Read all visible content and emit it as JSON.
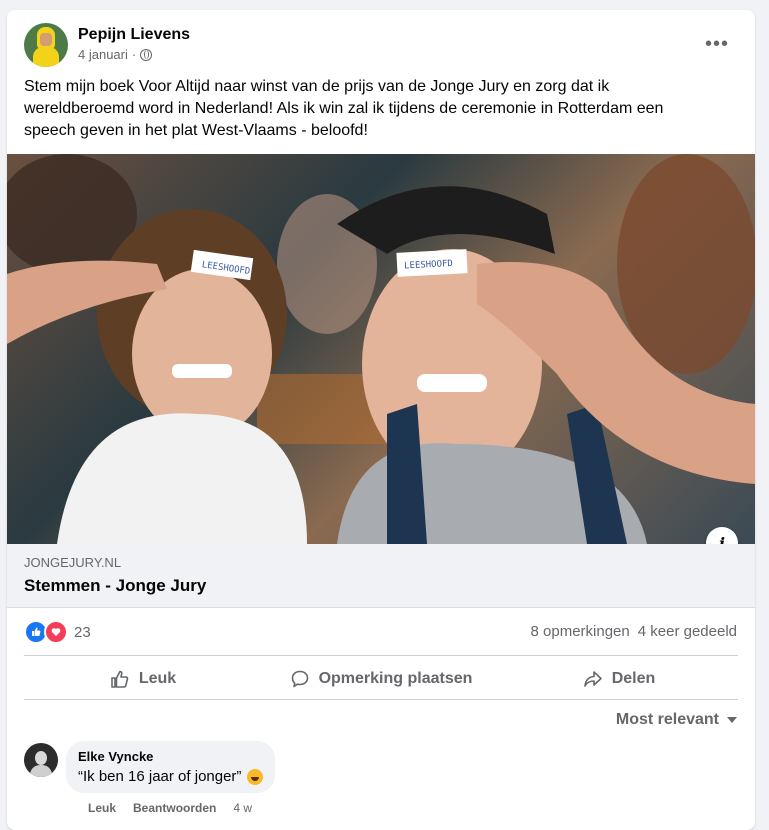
{
  "post": {
    "author": "Pepijn Lievens",
    "date": "4 januari",
    "text": "Stem mijn boek Voor Altijd naar winst van de prijs van de Jonge Jury en zorg dat ik wereldberoemd word in Nederland! Als ik win zal ik tijdens de ceremonie in Rotterdam een speech geven in het plat West-Vlaams - beloofd!",
    "more_icon": "ellipsis-icon"
  },
  "photo": {
    "sticker_left": "LEESHOOFD",
    "sticker_right": "LEESHOOFD",
    "info_label": "i"
  },
  "link": {
    "domain": "JONGEJURY.NL",
    "title": "Stemmen - Jonge Jury"
  },
  "stats": {
    "reaction_count": "23",
    "comments": "8 opmerkingen",
    "shares": "4 keer gedeeld"
  },
  "actions": {
    "like": "Leuk",
    "comment": "Opmerking plaatsen",
    "share": "Delen"
  },
  "sort": {
    "label": "Most relevant"
  },
  "comment": {
    "author": "Elke Vyncke",
    "text": "“Ik ben 16 jaar of jonger”",
    "like": "Leuk",
    "reply": "Beantwoorden",
    "time": "4 w"
  },
  "colors": {
    "like_blue": "#1877f2",
    "love_red": "#f33e58",
    "muted_text": "#65676b",
    "link_bg": "#f0f2f5"
  }
}
